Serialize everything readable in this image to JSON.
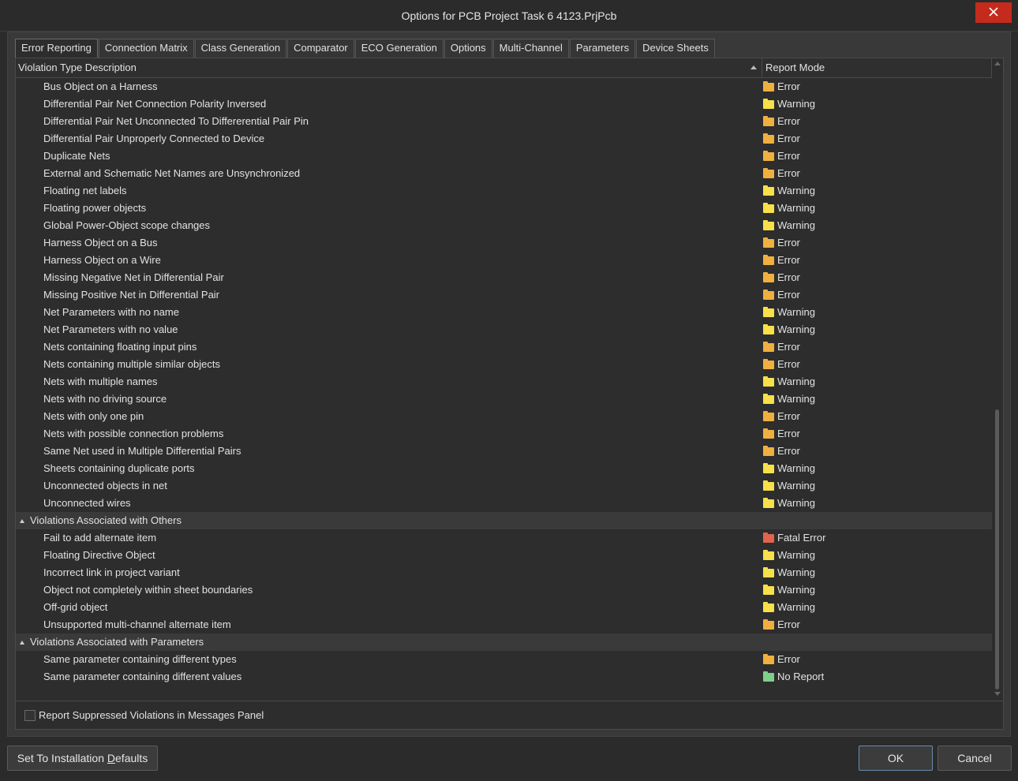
{
  "window": {
    "title": "Options for PCB Project Task 6 4123.PrjPcb",
    "close_glyph": "✕"
  },
  "tabs": [
    {
      "label": "Error Reporting",
      "active": true
    },
    {
      "label": "Connection Matrix"
    },
    {
      "label": "Class Generation"
    },
    {
      "label": "Comparator"
    },
    {
      "label": "ECO Generation"
    },
    {
      "label": "Options"
    },
    {
      "label": "Multi-Channel"
    },
    {
      "label": "Parameters"
    },
    {
      "label": "Device Sheets"
    }
  ],
  "grid": {
    "col_description": "Violation Type Description",
    "col_mode": "Report Mode",
    "mode_colors": {
      "Error": "#f0b040",
      "Warning": "#f7e04a",
      "Fatal Error": "#e0654e",
      "No Report": "#7fcf8c"
    },
    "rows": [
      {
        "type": "item",
        "desc": "Bus Object on a Harness",
        "mode": "Error"
      },
      {
        "type": "item",
        "desc": "Differential Pair Net Connection Polarity Inversed",
        "mode": "Warning"
      },
      {
        "type": "item",
        "desc": "Differential Pair Net Unconnected To Differerential Pair Pin",
        "mode": "Error"
      },
      {
        "type": "item",
        "desc": "Differential Pair Unproperly Connected to Device",
        "mode": "Error"
      },
      {
        "type": "item",
        "desc": "Duplicate Nets",
        "mode": "Error"
      },
      {
        "type": "item",
        "desc": "External and Schematic Net Names are Unsynchronized",
        "mode": "Error"
      },
      {
        "type": "item",
        "desc": "Floating net labels",
        "mode": "Warning"
      },
      {
        "type": "item",
        "desc": "Floating power objects",
        "mode": "Warning"
      },
      {
        "type": "item",
        "desc": "Global Power-Object scope changes",
        "mode": "Warning"
      },
      {
        "type": "item",
        "desc": "Harness Object on a Bus",
        "mode": "Error"
      },
      {
        "type": "item",
        "desc": "Harness Object on a Wire",
        "mode": "Error"
      },
      {
        "type": "item",
        "desc": "Missing Negative Net in Differential Pair",
        "mode": "Error"
      },
      {
        "type": "item",
        "desc": "Missing Positive Net in Differential Pair",
        "mode": "Error"
      },
      {
        "type": "item",
        "desc": "Net Parameters with no name",
        "mode": "Warning"
      },
      {
        "type": "item",
        "desc": "Net Parameters with no value",
        "mode": "Warning"
      },
      {
        "type": "item",
        "desc": "Nets containing floating input pins",
        "mode": "Error"
      },
      {
        "type": "item",
        "desc": "Nets containing multiple similar objects",
        "mode": "Error"
      },
      {
        "type": "item",
        "desc": "Nets with multiple names",
        "mode": "Warning"
      },
      {
        "type": "item",
        "desc": "Nets with no driving source",
        "mode": "Warning"
      },
      {
        "type": "item",
        "desc": "Nets with only one pin",
        "mode": "Error"
      },
      {
        "type": "item",
        "desc": "Nets with possible connection problems",
        "mode": "Error"
      },
      {
        "type": "item",
        "desc": "Same Net used in Multiple Differential Pairs",
        "mode": "Error"
      },
      {
        "type": "item",
        "desc": "Sheets containing duplicate ports",
        "mode": "Warning"
      },
      {
        "type": "item",
        "desc": "Unconnected objects in net",
        "mode": "Warning"
      },
      {
        "type": "item",
        "desc": "Unconnected wires",
        "mode": "Warning"
      },
      {
        "type": "group",
        "desc": "Violations Associated with Others"
      },
      {
        "type": "item",
        "desc": "Fail to add alternate item",
        "mode": "Fatal Error"
      },
      {
        "type": "item",
        "desc": "Floating Directive Object",
        "mode": "Warning"
      },
      {
        "type": "item",
        "desc": "Incorrect link in project variant",
        "mode": "Warning"
      },
      {
        "type": "item",
        "desc": "Object not completely within sheet boundaries",
        "mode": "Warning"
      },
      {
        "type": "item",
        "desc": "Off-grid object",
        "mode": "Warning"
      },
      {
        "type": "item",
        "desc": "Unsupported multi-channel alternate item",
        "mode": "Error"
      },
      {
        "type": "group",
        "desc": "Violations Associated with Parameters"
      },
      {
        "type": "item",
        "desc": "Same parameter containing different types",
        "mode": "Error"
      },
      {
        "type": "item",
        "desc": "Same parameter containing different values",
        "mode": "No Report"
      }
    ]
  },
  "footer": {
    "checkbox_label": "Report Suppressed Violations in Messages Panel",
    "checked": false
  },
  "buttons": {
    "defaults_pre": "Set To Installation ",
    "defaults_u": "D",
    "defaults_post": "efaults",
    "ok": "OK",
    "cancel": "Cancel"
  }
}
